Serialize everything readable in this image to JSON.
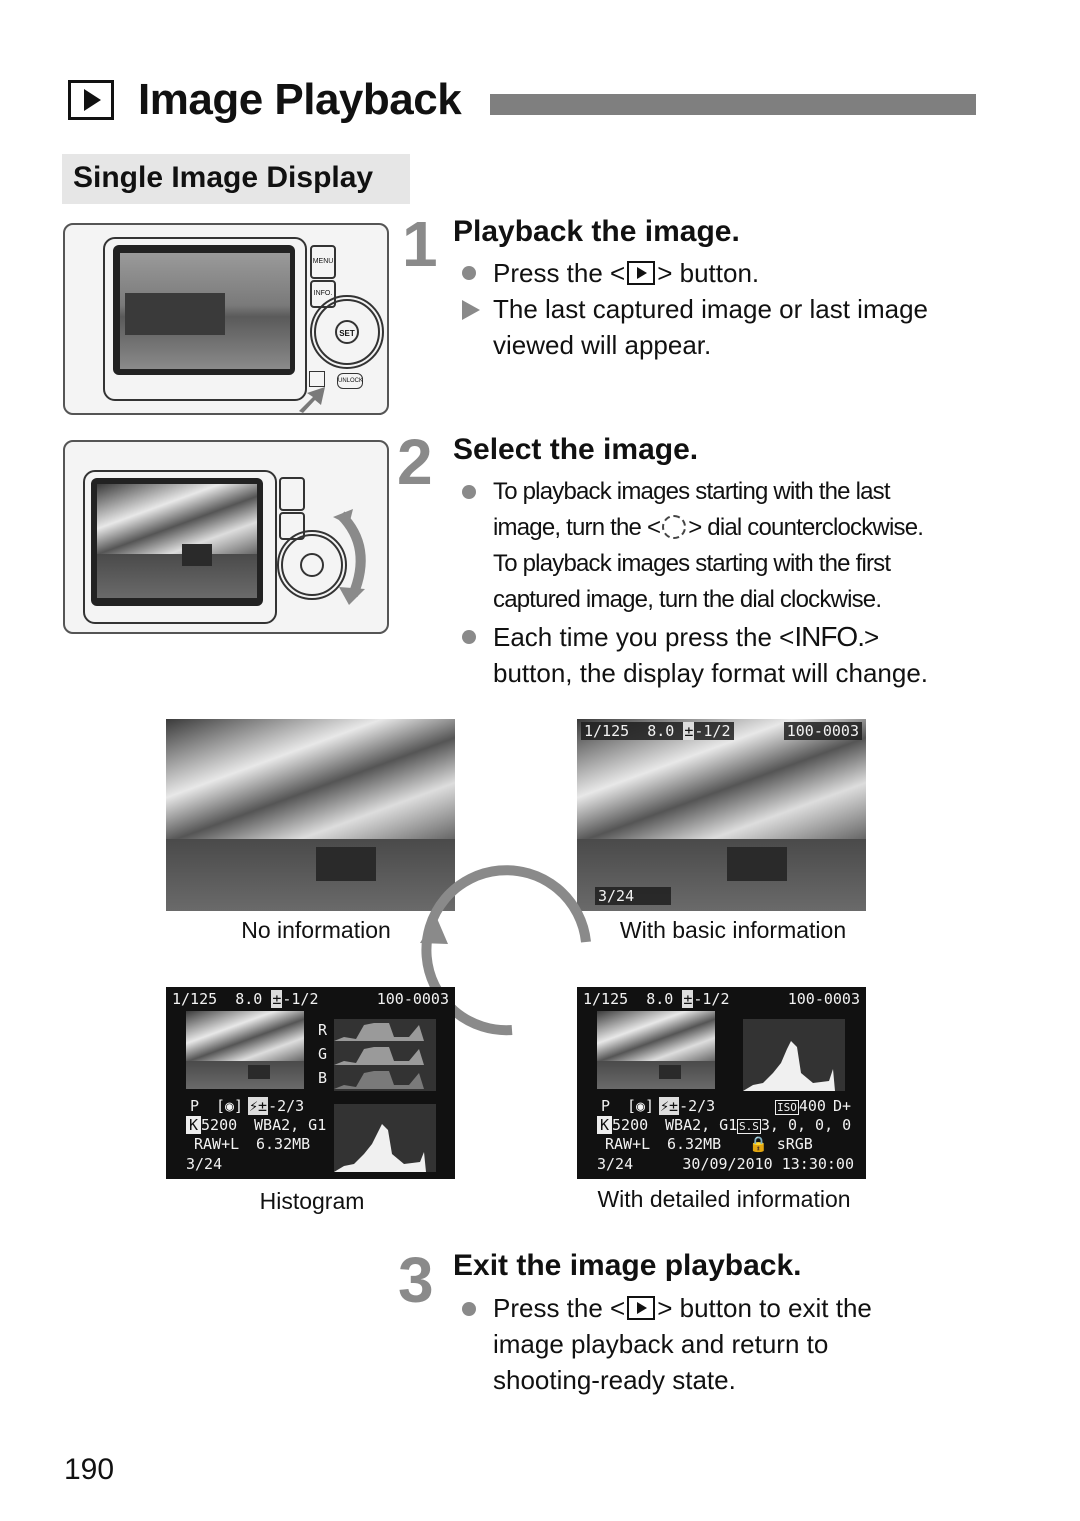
{
  "header": {
    "icon": "playback-icon",
    "title": "Image Playback",
    "section": "Single Image Display"
  },
  "steps": [
    {
      "number": "1",
      "title": "Playback the image.",
      "lines": [
        {
          "type": "bullet",
          "before": "Press the <",
          "icon": "playback-button-icon",
          "after": "> button."
        },
        {
          "type": "result",
          "text": "The last captured image or last image"
        },
        {
          "type": "cont",
          "text": "viewed will appear."
        }
      ]
    },
    {
      "number": "2",
      "title": "Select the image.",
      "lines": [
        {
          "type": "bullet",
          "text": "To playback images starting with the last"
        },
        {
          "type": "cont",
          "before": "image, turn the <",
          "icon": "quick-control-dial-icon",
          "after": "> dial counterclockwise."
        },
        {
          "type": "cont",
          "text": "To playback images starting with the first"
        },
        {
          "type": "cont",
          "text": "captured image, turn the dial clockwise."
        },
        {
          "type": "bullet",
          "before": "Each time you press the <",
          "glyph": "INFO.",
          "after": ">"
        },
        {
          "type": "cont",
          "text": "button, the display format will change."
        }
      ]
    },
    {
      "number": "3",
      "title": "Exit the image playback.",
      "lines": [
        {
          "type": "bullet",
          "before": "Press the <",
          "icon": "playback-button-icon",
          "after": "> button to exit the"
        },
        {
          "type": "cont",
          "text": "image playback and return to"
        },
        {
          "type": "cont",
          "text": "shooting-ready state."
        }
      ]
    }
  ],
  "camera_labels": {
    "menu": "MENU",
    "info": "INFO.",
    "set": "SET",
    "unlock": "UNLOCK"
  },
  "display_modes": [
    {
      "caption": "No information"
    },
    {
      "caption": "With basic information",
      "shutter": "1/125",
      "aperture": "8.0",
      "exposure_comp": "-1/2",
      "file_number": "100-0003",
      "frame": "3/24"
    },
    {
      "caption": "Histogram",
      "shutter": "1/125",
      "aperture": "8.0",
      "exposure_comp": "-1/2",
      "file_number": "100-0003",
      "mode": "P",
      "flash_comp": "-2/3",
      "color_temp": "5200",
      "wb_shift": "A2, G1",
      "quality": "RAW+L",
      "file_size": "6.32MB",
      "frame": "3/24",
      "channels": [
        "R",
        "G",
        "B"
      ]
    },
    {
      "caption": "With detailed information",
      "shutter": "1/125",
      "aperture": "8.0",
      "exposure_comp": "-1/2",
      "file_number": "100-0003",
      "mode": "P",
      "flash_comp": "-2/3",
      "iso": "400",
      "highlight_priority": "D+",
      "color_temp": "5200",
      "wb_shift": "A2, G1",
      "picture_style": "3, 0, 0, 0",
      "quality": "RAW+L",
      "file_size": "6.32MB",
      "color_space": "sRGB",
      "frame": "3/24",
      "datetime": "30/09/2010 13:30:00"
    }
  ],
  "page_number": "190",
  "colors": {
    "step_number": "#8a8a8a",
    "title_bar": "#7f7f7f",
    "section_bg": "#e6e6e6",
    "cycle_arrow": "#8a8a8a"
  }
}
